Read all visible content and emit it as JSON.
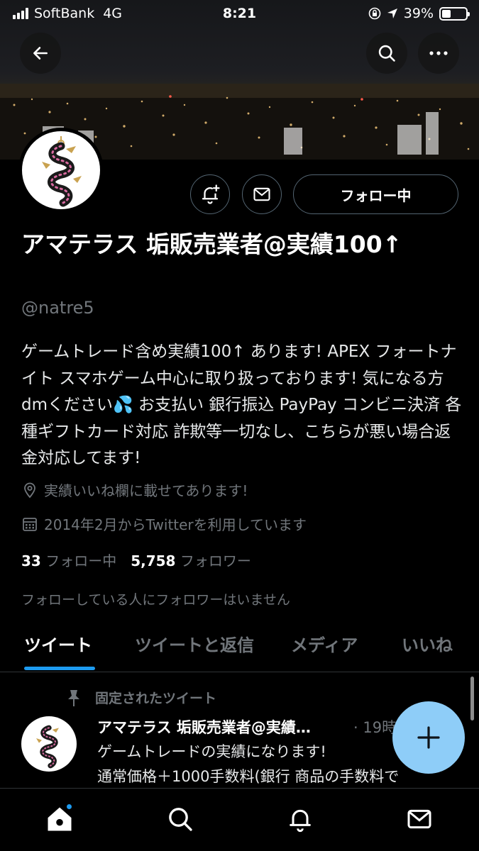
{
  "status_bar": {
    "carrier": "SoftBank",
    "network": "4G",
    "time": "8:21",
    "battery": "39%",
    "battery_level": 0.39
  },
  "header": {
    "back_icon": "arrow-left-icon",
    "search_icon": "search-icon",
    "more_icon": "more-dots-icon"
  },
  "profile": {
    "display_name": "アマテラス 垢販売業者@実績100↑",
    "handle": "@natre5",
    "bio": "ゲームトレード含め実績100↑ あります! APEX フォートナイト スマホゲーム中心に取り扱っております! 気になる方dmください💦 お支払い 銀行振込 PayPay コンビニ決済 各種ギフトカード対応 詐欺等一切なし、こちらが悪い場合返金対応してます!",
    "location": "実績いいね欄に載せてあります!",
    "joined": "2014年2月からTwitterを利用しています",
    "following_count": "33",
    "following_label": "フォロー中",
    "followers_count": "5,758",
    "followers_label": "フォロワー",
    "followers_note": "フォローしている人にフォロワーはいません",
    "follow_button": "フォロー中"
  },
  "tabs": [
    "ツイート",
    "ツイートと返信",
    "メディア",
    "いいね"
  ],
  "active_tab": 0,
  "pinned_tweet": {
    "pinned_label": "固定されたツイート",
    "author": "アマテラス 垢販売業者@実績…",
    "time": "· 19時",
    "line1": "ゲームトレードの実績になります!",
    "line2": "通常価格＋1000手数料(銀行 商品の手数料で"
  },
  "colors": {
    "accent": "#1d9bf0",
    "fab": "#8ecdf8",
    "muted": "#71767b",
    "border": "#2f3336"
  },
  "bottom_nav": [
    "home-icon",
    "search-icon",
    "bell-icon",
    "mail-icon"
  ]
}
